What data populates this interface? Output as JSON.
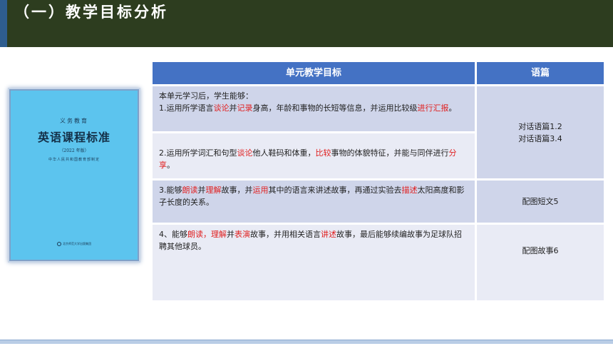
{
  "header": {
    "title": "（一）教学目标分析",
    "colors": {
      "background": "#2d3d1f",
      "accent": "#2e5d8f"
    }
  },
  "book": {
    "top_text": "义务教育",
    "title": "英语课程标准",
    "edition": "（2022 年版）",
    "ministry": "中华人民共和国教育部制定",
    "publisher": "北京师范大学出版集团",
    "color": "#5cc4ee"
  },
  "table": {
    "headers": [
      "单元教学目标",
      "语篇"
    ],
    "header_color": "#4472c4",
    "highlight_color": "#e02020",
    "rows": [
      {
        "goal_intro": "本单元学习后，学生能够：",
        "goal_segments": [
          {
            "text": "1.运用所学语言",
            "hl": false
          },
          {
            "text": "谈论",
            "hl": true
          },
          {
            "text": "并",
            "hl": false
          },
          {
            "text": "记录",
            "hl": true
          },
          {
            "text": "身高，年龄和事物的长短等信息，并运用比较级",
            "hl": false
          },
          {
            "text": "进行汇报",
            "hl": true
          },
          {
            "text": "。",
            "hl": false
          }
        ]
      },
      {
        "goal_segments": [
          {
            "text": "2.运用所学词汇和句型",
            "hl": false
          },
          {
            "text": "谈论",
            "hl": true
          },
          {
            "text": "他人鞋码和体重，",
            "hl": false
          },
          {
            "text": "比较",
            "hl": true
          },
          {
            "text": "事物的体貌特征，并能与同伴进行",
            "hl": false
          },
          {
            "text": "分享",
            "hl": true
          },
          {
            "text": "。",
            "hl": false
          }
        ]
      },
      {
        "goal_segments": [
          {
            "text": "3.能够",
            "hl": false
          },
          {
            "text": "朗读",
            "hl": true
          },
          {
            "text": "并",
            "hl": false
          },
          {
            "text": "理解",
            "hl": true
          },
          {
            "text": "故事，并",
            "hl": false
          },
          {
            "text": "运用",
            "hl": true
          },
          {
            "text": "其中的语言来讲述故事，再通过实验去",
            "hl": false
          },
          {
            "text": "描述",
            "hl": true
          },
          {
            "text": "太阳高度和影子长度的关系。",
            "hl": false
          }
        ]
      },
      {
        "goal_segments": [
          {
            "text": "4、能够",
            "hl": false
          },
          {
            "text": "朗读，理解",
            "hl": true
          },
          {
            "text": "并",
            "hl": false
          },
          {
            "text": "表演",
            "hl": true
          },
          {
            "text": "故事，并用相关语言",
            "hl": false
          },
          {
            "text": "讲述",
            "hl": true
          },
          {
            "text": "故事，最后能够续编故事为足球队招聘其他球员。",
            "hl": false
          }
        ]
      }
    ],
    "texts": {
      "rows_1_2": [
        "对话语篇1.2",
        "对话语篇3.4"
      ],
      "row_3": "配图短文5",
      "row_4": "配图故事6"
    }
  }
}
